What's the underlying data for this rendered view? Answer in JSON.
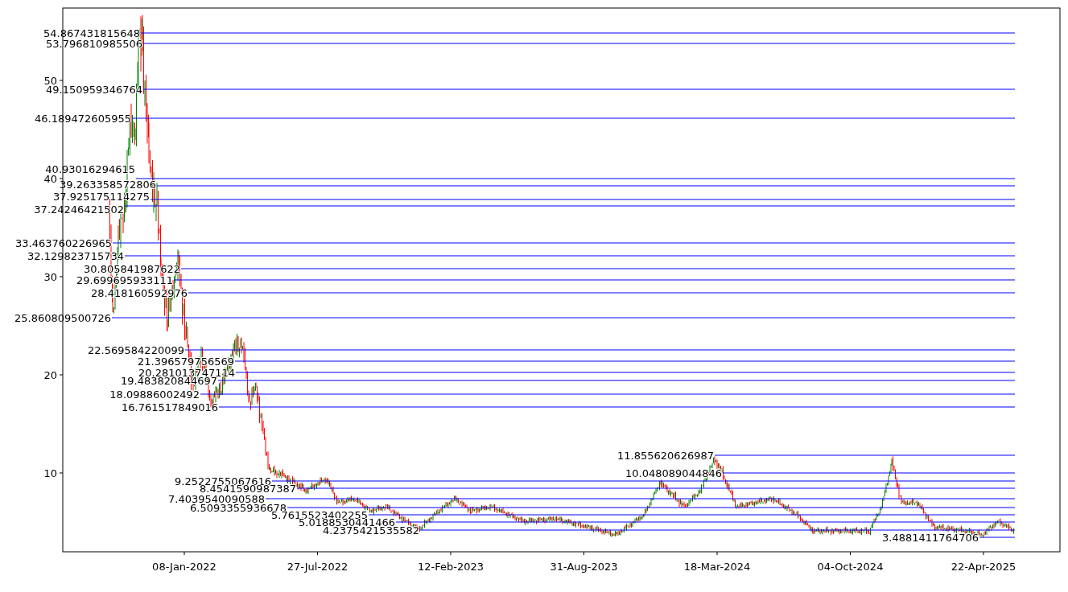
{
  "plot": {
    "y_ticks": [
      "50",
      "40",
      "30",
      "20",
      "10"
    ],
    "x_ticks": [
      "08-Jan-2022",
      "27-Jul-2022",
      "12-Feb-2023",
      "31-Aug-2023",
      "18-Mar-2024",
      "04-Oct-2024",
      "22-Apr-2025"
    ],
    "levels": [
      {
        "text": "54.867431815648"
      },
      {
        "text": "53.796810985506"
      },
      {
        "text": "49.150959346764"
      },
      {
        "text": "46.189472605955"
      },
      {
        "text": "40.93016294615"
      },
      {
        "text": "39.263358572806"
      },
      {
        "text": "37.925175114275"
      },
      {
        "text": "37.24246421502"
      },
      {
        "text": "33.463760226965"
      },
      {
        "text": "32.129823715734"
      },
      {
        "text": "30.805841987622"
      },
      {
        "text": "29.699695933111"
      },
      {
        "text": "28.418160592976"
      },
      {
        "text": "25.860809500726"
      },
      {
        "text": "22.569584220099"
      },
      {
        "text": "21.396579756569"
      },
      {
        "text": "20.281013747114"
      },
      {
        "text": "19.483820844697"
      },
      {
        "text": "18.09886002492"
      },
      {
        "text": "16.761517849016"
      },
      {
        "text": "11.855620626987"
      },
      {
        "text": "10.048089044846"
      },
      {
        "text": "9.2522755067616"
      },
      {
        "text": "8.4541590987387"
      },
      {
        "text": "7.4039540090588"
      },
      {
        "text": "6.5093355936678"
      },
      {
        "text": "5.7615523402255"
      },
      {
        "text": "5.0188530441466"
      },
      {
        "text": "4.2375421535582"
      },
      {
        "text": "3.4881411764706"
      }
    ]
  }
}
